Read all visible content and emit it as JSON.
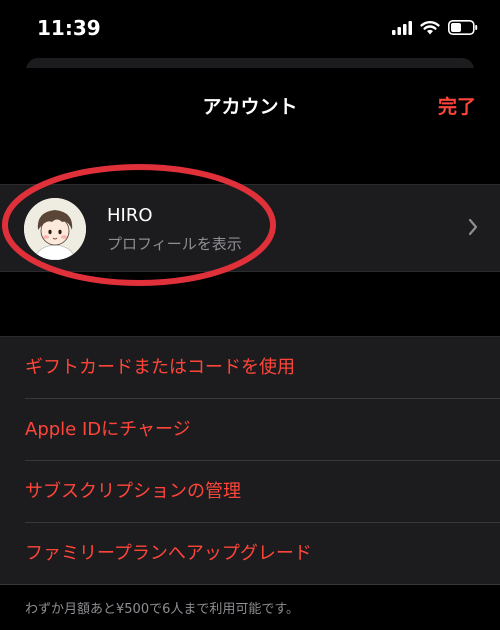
{
  "status_bar": {
    "time": "11:39",
    "icons": [
      "signal-icon",
      "wifi-icon",
      "battery-icon"
    ]
  },
  "header": {
    "title": "アカウント",
    "done_label": "完了"
  },
  "profile": {
    "name": "HIRO",
    "subtitle": "プロフィールを表示"
  },
  "menu": {
    "items": [
      {
        "label": "ギフトカードまたはコードを使用"
      },
      {
        "label": "Apple IDにチャージ"
      },
      {
        "label": "サブスクリプションの管理"
      },
      {
        "label": "ファミリープランへアップグレード"
      }
    ]
  },
  "footer": {
    "note": "わずか月額あと¥500で6人まで利用可能です。"
  },
  "colors": {
    "accent": "#ff453a",
    "background": "#000000",
    "cell": "#1c1c1e",
    "secondary_text": "#8e8e93",
    "annotation": "#e0313b"
  }
}
